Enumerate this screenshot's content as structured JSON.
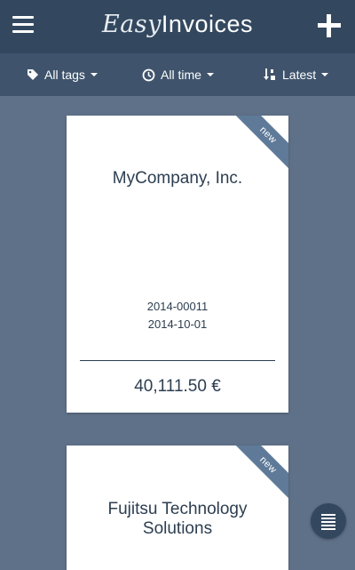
{
  "header": {
    "logo_part1": "Easy",
    "logo_part2": "Invoices",
    "menu_icon": "hamburger-menu-icon",
    "add_icon": "plus-icon"
  },
  "filters": [
    {
      "label": "All tags",
      "icon": "tag-icon"
    },
    {
      "label": "All time",
      "icon": "clock-icon"
    },
    {
      "label": "Latest",
      "icon": "sort-icon"
    }
  ],
  "invoices": [
    {
      "ribbon": "new",
      "company": "MyCompany, Inc.",
      "number": "2014-00011",
      "date": "2014-10-01",
      "amount": "40,111.50 €"
    },
    {
      "ribbon": "new",
      "company": "Fujitsu Technology Solutions"
    }
  ],
  "fab_icon": "list-view-icon",
  "colors": {
    "background": "#5f7189",
    "topbar": "#33485f",
    "filterbar": "#3f546c",
    "ribbon": "#5e7a98",
    "text": "#2c3e50"
  }
}
